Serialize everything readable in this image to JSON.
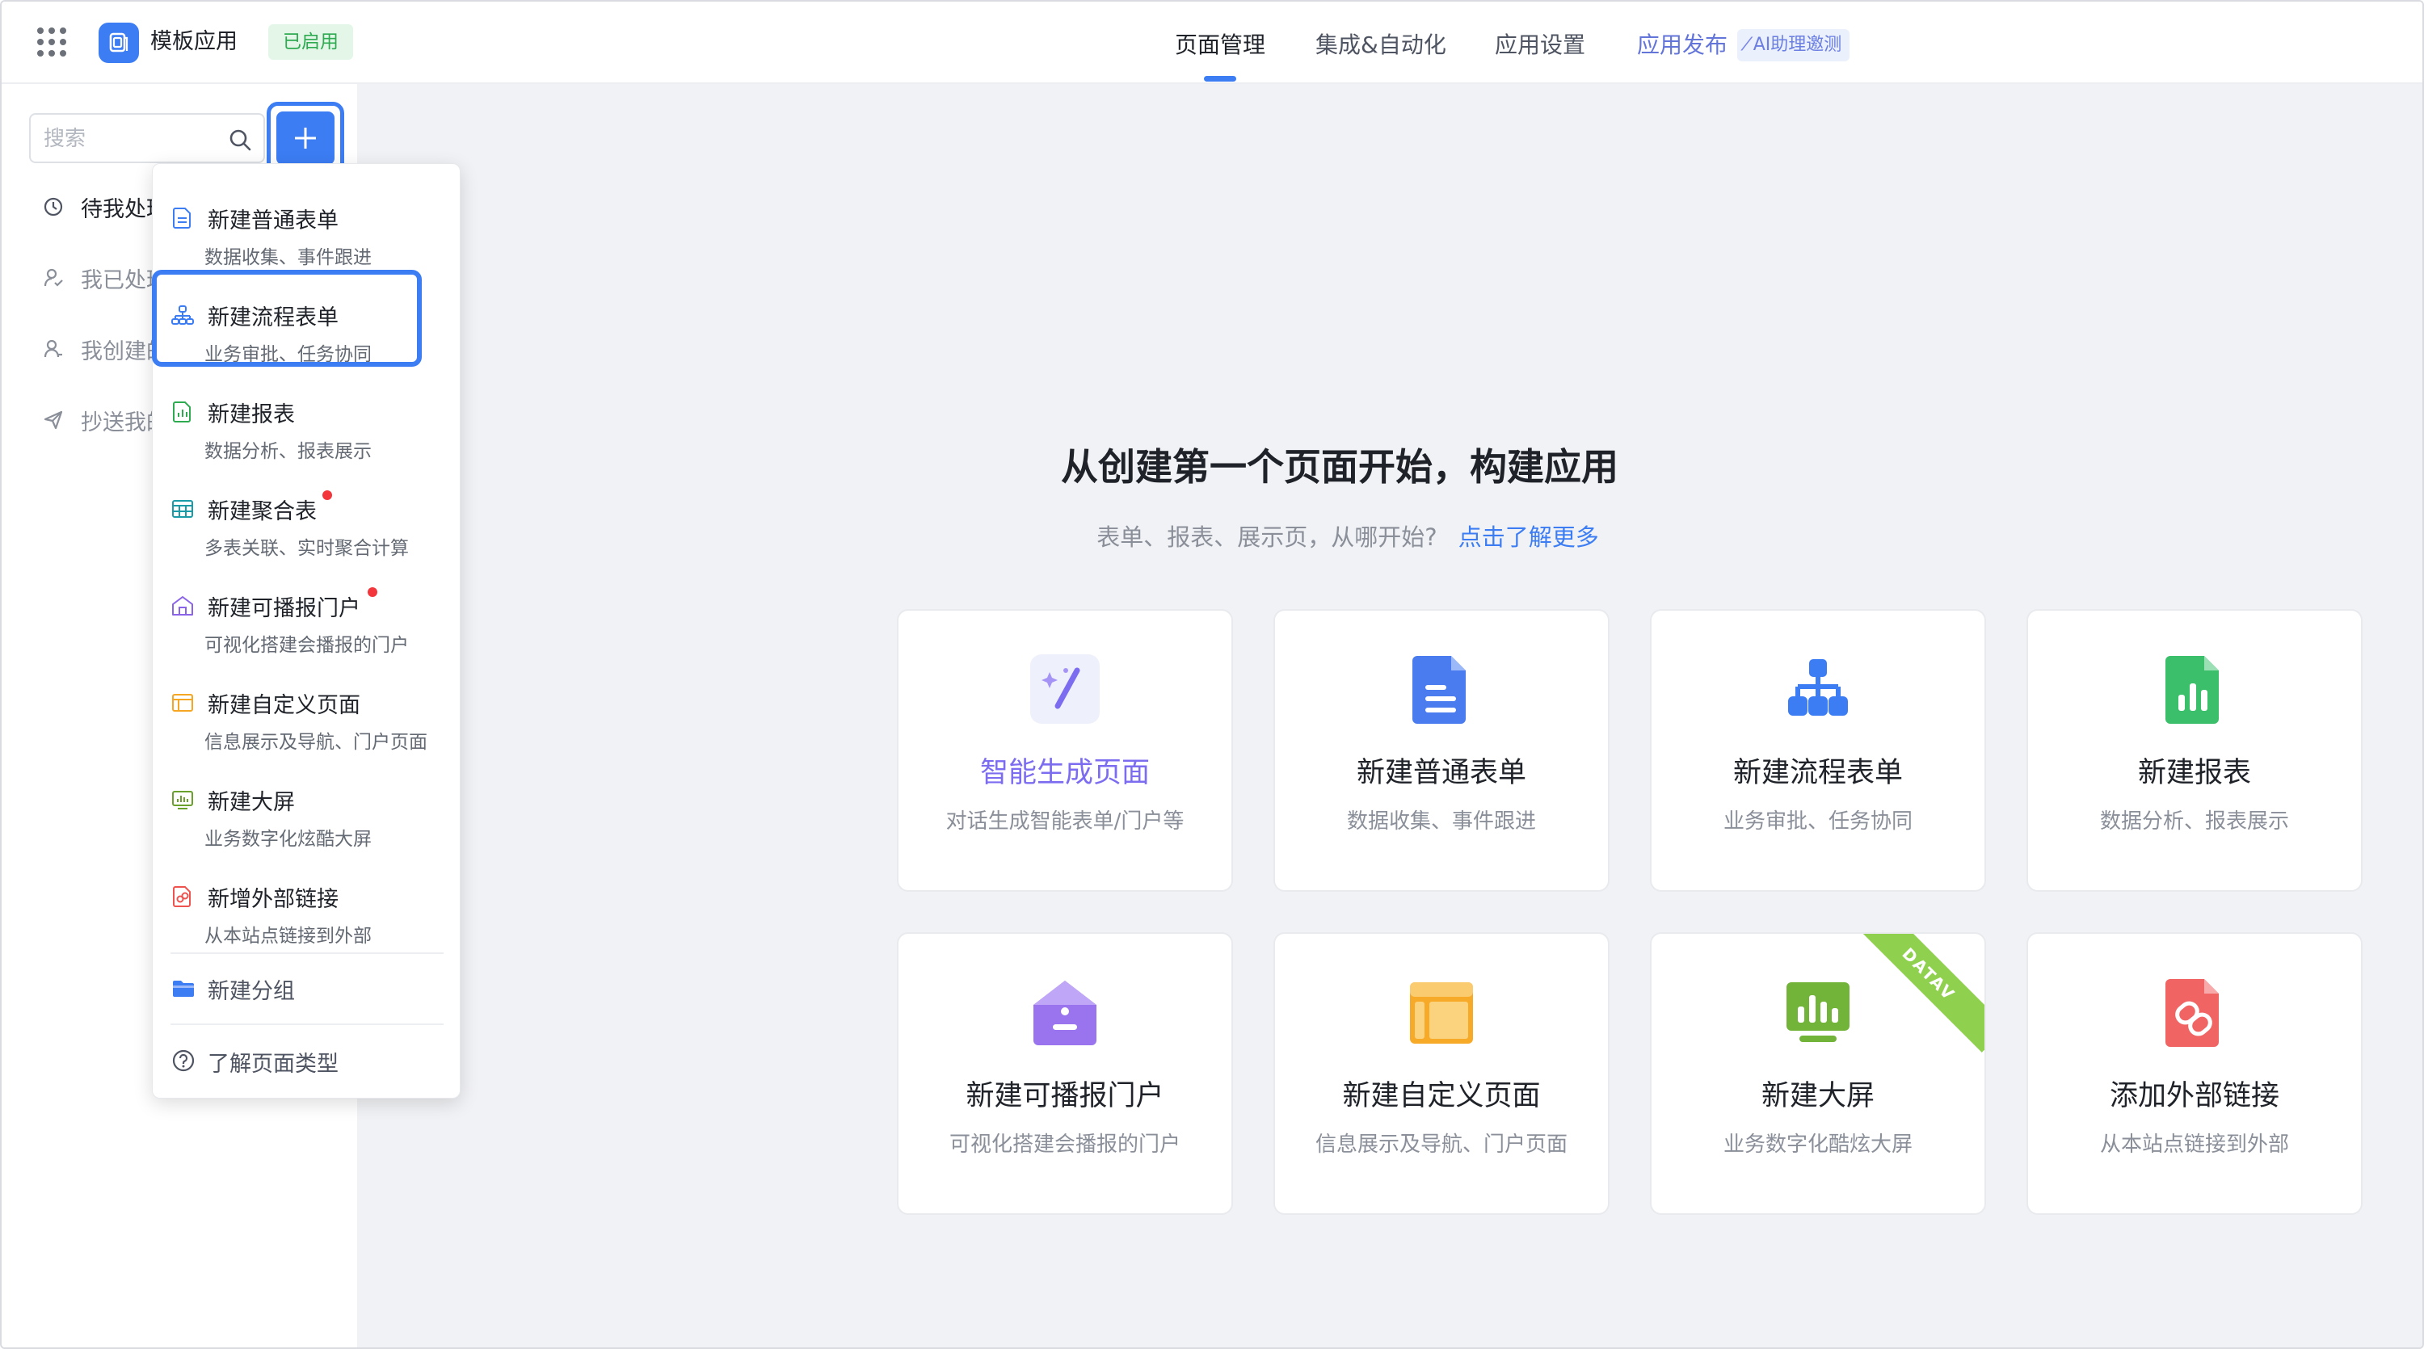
{
  "app": {
    "name": "模板应用",
    "status": "已启用"
  },
  "nav": {
    "tabs": [
      {
        "label": "页面管理",
        "active": true
      },
      {
        "label": "集成&自动化",
        "active": false
      },
      {
        "label": "应用设置",
        "active": false
      },
      {
        "label": "应用发布",
        "active": false
      }
    ],
    "ai_badge": "AI助理邀测"
  },
  "sidebar": {
    "search_placeholder": "搜索",
    "items": [
      {
        "label": "待我处理",
        "icon": "clock-icon"
      },
      {
        "label": "我已处理",
        "icon": "user-check-icon"
      },
      {
        "label": "我创建的",
        "icon": "user-icon"
      },
      {
        "label": "抄送我的",
        "icon": "send-icon"
      }
    ]
  },
  "dropdown": {
    "items": [
      {
        "title": "新建普通表单",
        "desc": "数据收集、事件跟进",
        "icon": "form-icon",
        "color": "#3c7df4",
        "new": false
      },
      {
        "title": "新建流程表单",
        "desc": "业务审批、任务协同",
        "icon": "workflow-icon",
        "color": "#3c7df4",
        "new": false
      },
      {
        "title": "新建报表",
        "desc": "数据分析、报表展示",
        "icon": "report-icon",
        "color": "#2eaa51",
        "new": false
      },
      {
        "title": "新建聚合表",
        "desc": "多表关联、实时聚合计算",
        "icon": "aggregate-icon",
        "color": "#1a9ba8",
        "new": true
      },
      {
        "title": "新建可播报门户",
        "desc": "可视化搭建会播报的门户",
        "icon": "portal-icon",
        "color": "#8a63e8",
        "new": true
      },
      {
        "title": "新建自定义页面",
        "desc": "信息展示及导航、门户页面",
        "icon": "custom-page-icon",
        "color": "#f5a623",
        "new": false
      },
      {
        "title": "新建大屏",
        "desc": "业务数字化炫酷大屏",
        "icon": "screen-icon",
        "color": "#6aa12c",
        "new": false
      },
      {
        "title": "新增外部链接",
        "desc": "从本站点链接到外部",
        "icon": "link-icon",
        "color": "#ef5350",
        "new": false
      }
    ],
    "group_label": "新建分组",
    "help_label": "了解页面类型"
  },
  "hero": {
    "title": "从创建第一个页面开始，构建应用",
    "subtitle": "表单、报表、展示页，从哪开始?",
    "link": "点击了解更多"
  },
  "cards": [
    {
      "title": "智能生成页面",
      "desc": "对话生成智能表单/门户等",
      "icon": "magic-wand-icon"
    },
    {
      "title": "新建普通表单",
      "desc": "数据收集、事件跟进",
      "icon": "form-icon"
    },
    {
      "title": "新建流程表单",
      "desc": "业务审批、任务协同",
      "icon": "workflow-icon"
    },
    {
      "title": "新建报表",
      "desc": "数据分析、报表展示",
      "icon": "report-icon"
    },
    {
      "title": "新建可播报门户",
      "desc": "可视化搭建会播报的门户",
      "icon": "portal-icon"
    },
    {
      "title": "新建自定义页面",
      "desc": "信息展示及导航、门户页面",
      "icon": "custom-page-icon"
    },
    {
      "title": "新建大屏",
      "desc": "业务数字化酷炫大屏",
      "icon": "screen-icon",
      "ribbon": "DATAV"
    },
    {
      "title": "添加外部链接",
      "desc": "从本站点链接到外部",
      "icon": "link-icon"
    }
  ]
}
